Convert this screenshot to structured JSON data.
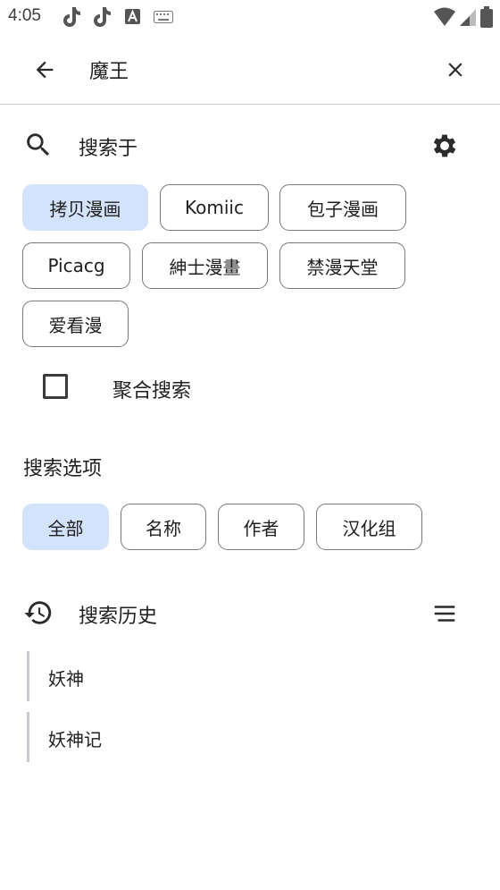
{
  "status_bar": {
    "time": "4:05",
    "icons": [
      "tiktok-icon",
      "tiktok-icon",
      "text-icon",
      "keyboard-icon",
      "wifi-icon",
      "signal-icon",
      "battery-icon"
    ]
  },
  "search_bar": {
    "query": "魔王",
    "back_icon": "arrow-left-icon",
    "clear_icon": "close-icon"
  },
  "search_in": {
    "title": "搜索于",
    "settings_icon": "gear-icon",
    "sources": [
      {
        "label": "拷贝漫画",
        "selected": true
      },
      {
        "label": "Komiic",
        "selected": false
      },
      {
        "label": "包子漫画",
        "selected": false
      },
      {
        "label": "Picacg",
        "selected": false
      },
      {
        "label": "紳士漫畫",
        "selected": false
      },
      {
        "label": "禁漫天堂",
        "selected": false
      },
      {
        "label": "爱看漫",
        "selected": false
      }
    ],
    "aggregate": {
      "label": "聚合搜索",
      "checked": false
    }
  },
  "search_options": {
    "title": "搜索选项",
    "options": [
      {
        "label": "全部",
        "selected": true
      },
      {
        "label": "名称",
        "selected": false
      },
      {
        "label": "作者",
        "selected": false
      },
      {
        "label": "汉化组",
        "selected": false
      }
    ]
  },
  "history": {
    "title": "搜索历史",
    "items": [
      "妖神",
      "妖神记"
    ]
  },
  "colors": {
    "chip_selected_bg": "#d4e3fc",
    "chip_border": "#7a7a7a",
    "divider": "#c9c9c9"
  }
}
